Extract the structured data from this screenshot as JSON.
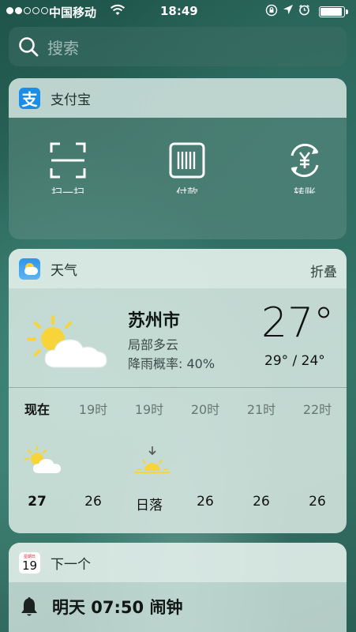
{
  "status_bar": {
    "carrier": "中国移动",
    "time": "18:49",
    "battery_level": 0.95,
    "signal_bars_filled": 2,
    "signal_bars_total": 5
  },
  "search": {
    "placeholder": "搜索"
  },
  "alipay": {
    "title": "支付宝",
    "app_icon_glyph": "支",
    "actions": [
      {
        "label": "扫一扫",
        "icon": "scan-icon"
      },
      {
        "label": "付款",
        "icon": "barcode-icon"
      },
      {
        "label": "转账",
        "icon": "yuan-transfer-icon"
      }
    ]
  },
  "weather": {
    "title": "天气",
    "action": "折叠",
    "city": "苏州市",
    "condition": "局部多云",
    "rain_chance": "降雨概率: 40%",
    "current_temp": "27°",
    "temp_range": "29° / 24°",
    "hours": [
      {
        "label": "现在",
        "icon": "partly-cloudy-icon",
        "value": "27"
      },
      {
        "label": "19时",
        "icon": "",
        "value": "26"
      },
      {
        "label": "19时",
        "icon": "sunset-icon",
        "value": "日落"
      },
      {
        "label": "20时",
        "icon": "",
        "value": "26"
      },
      {
        "label": "21时",
        "icon": "",
        "value": "26"
      },
      {
        "label": "22时",
        "icon": "",
        "value": "26"
      }
    ]
  },
  "next": {
    "title": "下一个",
    "calendar_day": "19",
    "calendar_weekday": "星期日",
    "alarm": "明天 07:50 闹钟"
  }
}
